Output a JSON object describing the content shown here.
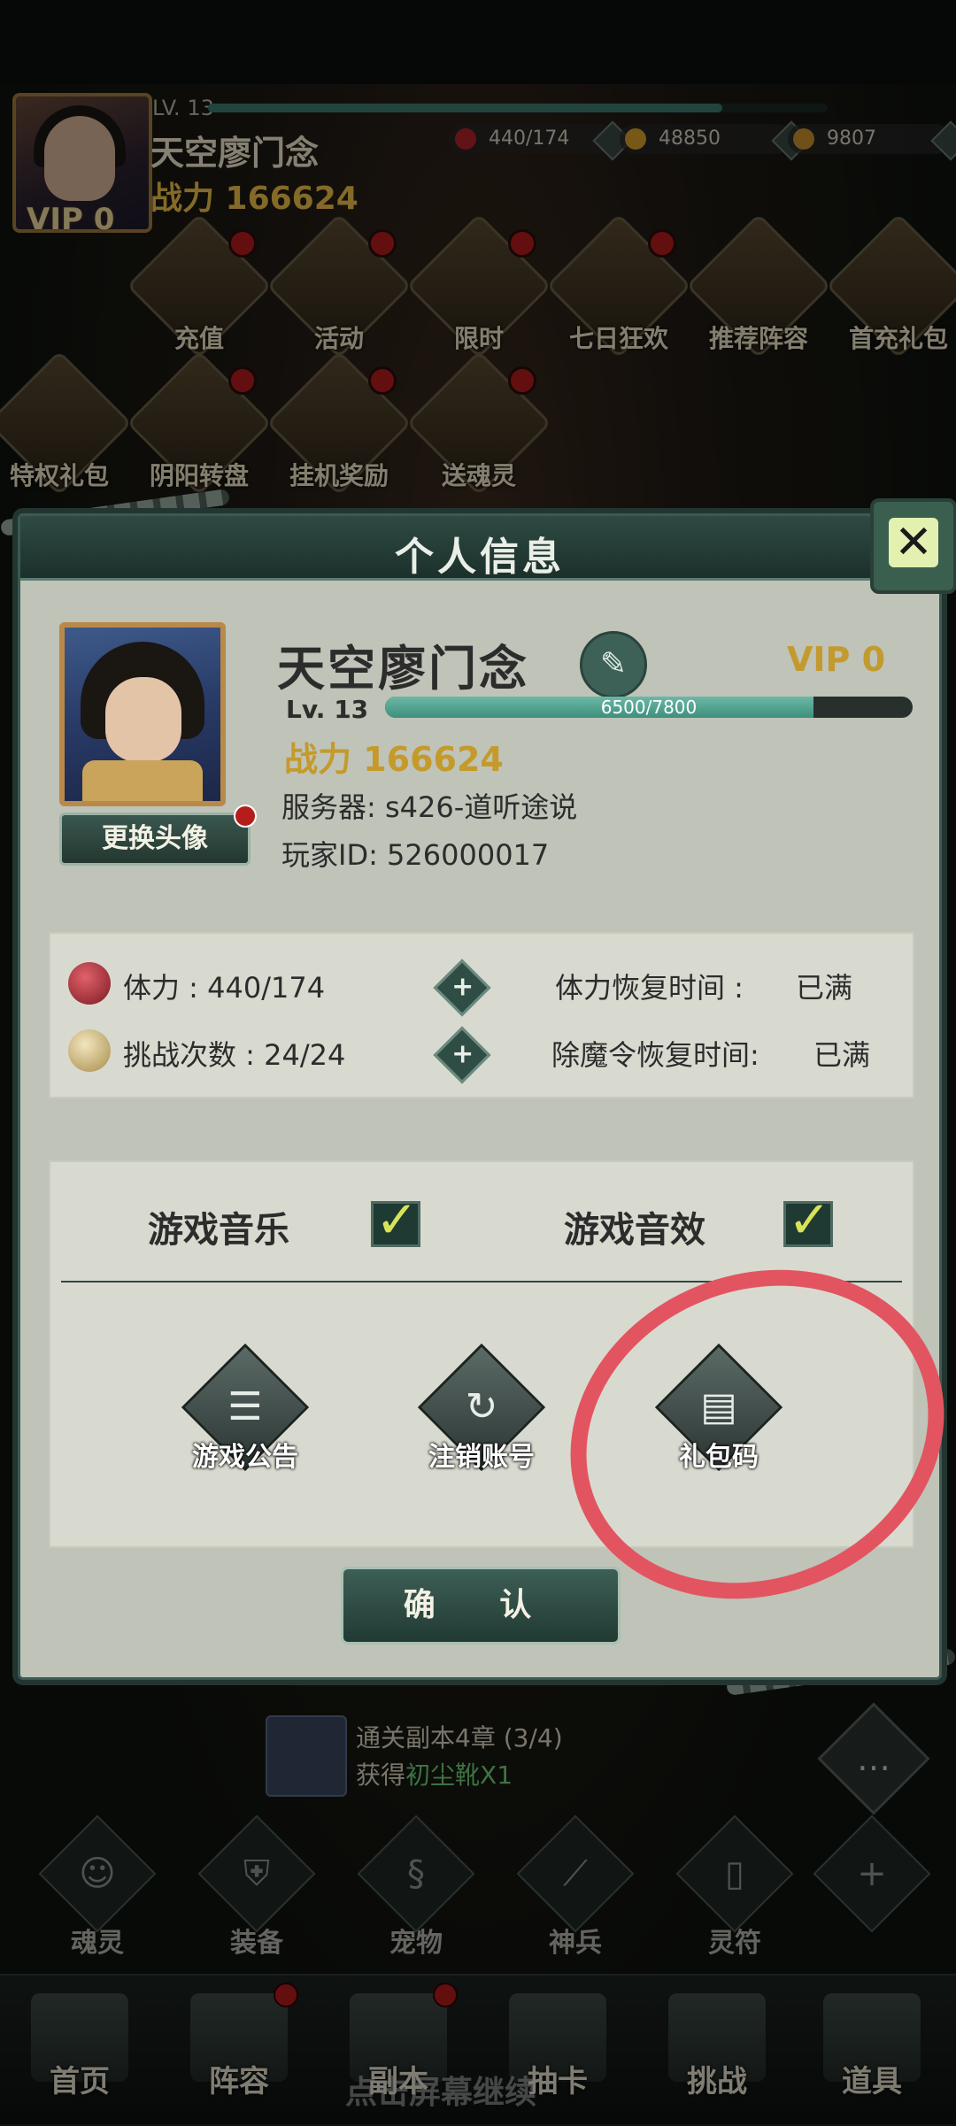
{
  "header": {
    "vip": "VIP 0",
    "level": "LV. 13",
    "name": "天空廖门念",
    "power": "战力 166624",
    "resources": [
      {
        "value": "440/174",
        "icon": "stamina-icon",
        "color": "#b3242a"
      },
      {
        "value": "48850",
        "icon": "gold-coin-icon",
        "color": "#d9a12a"
      },
      {
        "value": "9807",
        "icon": "ingot-icon",
        "color": "#c9932c"
      }
    ]
  },
  "menu": [
    {
      "label": "充值",
      "icon": "recharge-icon",
      "dot": true
    },
    {
      "label": "活动",
      "icon": "activity-icon",
      "dot": true
    },
    {
      "label": "限时",
      "icon": "limited-time-icon",
      "dot": true
    },
    {
      "label": "七日狂欢",
      "icon": "seven-day-icon",
      "dot": true
    },
    {
      "label": "推荐阵容",
      "icon": "lineup-icon",
      "dot": false
    },
    {
      "label": "首充礼包",
      "icon": "first-charge-gift-icon",
      "dot": false
    },
    {
      "label": "特权礼包",
      "icon": "privilege-gift-icon",
      "dot": false
    },
    {
      "label": "阴阳转盘",
      "icon": "wheel-icon",
      "dot": true
    },
    {
      "label": "挂机奖励",
      "icon": "idle-reward-icon",
      "dot": true
    },
    {
      "label": "送魂灵",
      "icon": "soul-gift-icon",
      "dot": true
    }
  ],
  "modal": {
    "title": "个人信息",
    "close": "✕",
    "change_avatar": "更换头像",
    "name": "天空廖门念",
    "vip": "VIP 0",
    "level": "Lv. 13",
    "exp_text": "6500/7800",
    "exp_progress": 0.8125,
    "power": "战力 166624",
    "server": "服务器:  s426-道听途说",
    "player_id": "玩家ID:  526000017",
    "stamina_label": "体力 : 440/174",
    "challenge_label": "挑战次数 : 24/24",
    "stamina_recover_label": "体力恢复时间 :",
    "stamina_recover_value": "已满",
    "demon_recover_label": "除魔令恢复时间:",
    "demon_recover_value": "已满",
    "music_label": "游戏音乐",
    "sfx_label": "游戏音效",
    "music_on": true,
    "sfx_on": true,
    "actions": [
      {
        "label": "游戏公告",
        "icon": "announcement-icon",
        "glyph": "☰"
      },
      {
        "label": "注销账号",
        "icon": "logout-icon",
        "glyph": "↻"
      },
      {
        "label": "礼包码",
        "icon": "gift-code-icon",
        "glyph": "▤"
      }
    ],
    "confirm": "确 认",
    "annotation_color": "#e25560"
  },
  "quest": {
    "line1": "通关副本4章 (3/4)",
    "line2_prefix": "获得",
    "line2_reward": "初尘靴X1"
  },
  "sub_nav": [
    {
      "label": "魂灵",
      "icon": "soul-icon",
      "glyph": "☺"
    },
    {
      "label": "装备",
      "icon": "equipment-icon",
      "glyph": "⛨"
    },
    {
      "label": "宠物",
      "icon": "pet-icon",
      "glyph": "§"
    },
    {
      "label": "神兵",
      "icon": "weapon-icon",
      "glyph": "⟋"
    },
    {
      "label": "灵符",
      "icon": "talisman-icon",
      "glyph": "▯"
    },
    {
      "label": "",
      "icon": "plus-icon",
      "glyph": "+"
    }
  ],
  "bottom_nav": [
    {
      "label": "首页",
      "icon": "home-icon",
      "dot": false
    },
    {
      "label": "阵容",
      "icon": "lineup-nav-icon",
      "dot": true
    },
    {
      "label": "副本",
      "icon": "dungeon-icon",
      "dot": true
    },
    {
      "label": "抽卡",
      "icon": "summon-icon",
      "dot": false
    },
    {
      "label": "挑战",
      "icon": "challenge-icon",
      "dot": false
    },
    {
      "label": "道具",
      "icon": "items-icon",
      "dot": false
    }
  ],
  "watermark": "点击屏幕继续"
}
